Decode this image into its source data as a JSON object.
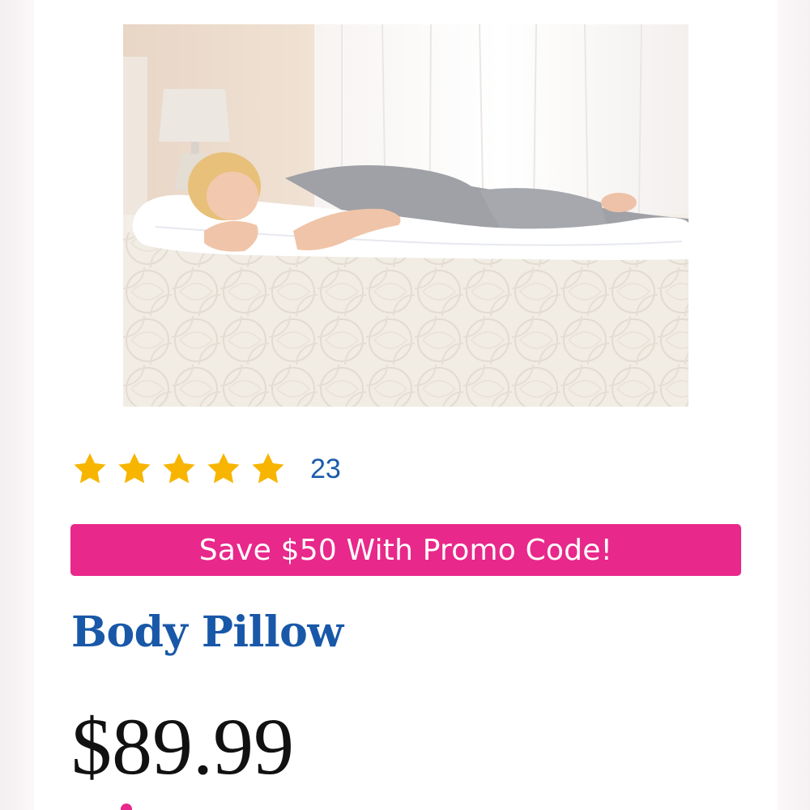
{
  "product": {
    "image_alt": "Woman sleeping hugging a long white body pillow on a bed",
    "rating": {
      "stars": 5,
      "max_stars": 5,
      "review_count": "23",
      "star_color": "#f7b500"
    },
    "promo": {
      "label": "Save $50 With Promo Code!",
      "color": "#e8288a"
    },
    "title": "Body Pillow",
    "price": "$89.99"
  },
  "colors": {
    "accent_blue": "#1958a8",
    "promo_pink": "#e8288a",
    "star_gold": "#f7b500"
  }
}
